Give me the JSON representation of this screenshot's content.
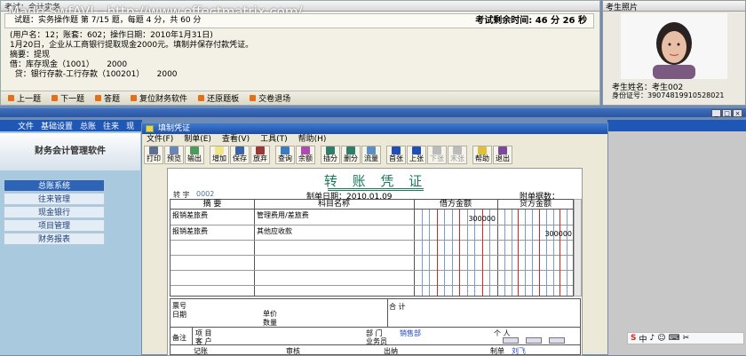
{
  "exam": {
    "title": "考试：会计实务",
    "watermark": "Made SwfAVI - http://www.effectmatrix.com/",
    "info": "试题：实务操作题 第 7/15 题，每题 4 分，共 60 分",
    "timer": "考试剩余时间:  46 分  26 秒",
    "question": "(用户名：12；账套：602；操作日期：2010年1月31日)\n1月20日，企业从工商银行提取现金2000元。填制并保存付款凭证。\n摘要：提现\n借：库存现金（1001）     2000\n  贷：银行存款-工行存款（100201）     2000",
    "buttons": [
      "上一题",
      "下一题",
      "答题",
      "复位财务软件",
      "还原题板",
      "交卷退场"
    ]
  },
  "photo": {
    "title": "考生照片",
    "name": "考生姓名：考生002",
    "id": "身份证号：39074819910528021"
  },
  "app": {
    "menu": [
      "文件",
      "基础设置",
      "总账",
      "往来",
      "现"
    ],
    "brand": "财务会计管理软件",
    "nav": [
      "总账系统",
      "往来管理",
      "现金银行",
      "项目管理",
      "财务报表"
    ],
    "tray": [
      "中",
      "♪",
      "☺",
      "⌨",
      "✂"
    ]
  },
  "dialog": {
    "title": "填制凭证",
    "menu": [
      "文件(F)",
      "制单(E)",
      "查看(V)",
      "工具(T)",
      "帮助(H)"
    ],
    "toolbar": [
      {
        "label": "打印",
        "color": "#5f6f8f",
        "enabled": true
      },
      {
        "label": "预览",
        "color": "#6a86b8",
        "enabled": true
      },
      {
        "label": "输出",
        "color": "#4e9a5e",
        "enabled": true
      },
      {
        "label": "增加",
        "color": "#f1e58a",
        "enabled": true
      },
      {
        "label": "保存",
        "color": "#3a64a8",
        "enabled": true
      },
      {
        "label": "放弃",
        "color": "#9a3838",
        "enabled": true
      },
      {
        "label": "查询",
        "color": "#3c7ac0",
        "enabled": true
      },
      {
        "label": "余额",
        "color": "#b04ab0",
        "enabled": true
      },
      {
        "label": "插分",
        "color": "#2e7e6a",
        "enabled": true
      },
      {
        "label": "删分",
        "color": "#2e7e6a",
        "enabled": true
      },
      {
        "label": "流量",
        "color": "#5b8fc6",
        "enabled": true
      },
      {
        "label": "首张",
        "color": "#1f4fb5",
        "enabled": true
      },
      {
        "label": "上张",
        "color": "#1f4fb5",
        "enabled": true
      },
      {
        "label": "下张",
        "color": "#bbbbbb",
        "enabled": false
      },
      {
        "label": "末张",
        "color": "#bbbbbb",
        "enabled": false
      },
      {
        "label": "帮助",
        "color": "#e0c03a",
        "enabled": true
      },
      {
        "label": "退出",
        "color": "#7a4a9a",
        "enabled": true
      }
    ]
  },
  "voucher": {
    "title": "转 账 凭 证",
    "zi_label": "转  字",
    "number": "0002",
    "date": "制单日期：2010.01.09",
    "attachments": "附单据数：",
    "headers": {
      "summary": "摘  要",
      "account": "科目名称",
      "debit": "借方金额",
      "credit": "贷方金额"
    },
    "rows": [
      {
        "summary": "报销差旅费",
        "account": "管理费用/差旅费",
        "debit": "300000",
        "credit": ""
      },
      {
        "summary": "报销差旅费",
        "account": "其他应收款",
        "debit": "",
        "credit": "300000"
      }
    ],
    "footer": {
      "ticket": "票号",
      "date": "日期",
      "price": "单价",
      "qty": "数量",
      "total": "合  计",
      "remark": "备注",
      "project": "项  目",
      "customer": "客  户",
      "dept_label": "部  门",
      "dept": "销售部",
      "person": "个  人",
      "salesman": "业务员",
      "bookkeeper": "记账",
      "reviewer": "审核",
      "cashier": "出纳",
      "maker_label": "制单",
      "maker": "刘飞"
    }
  }
}
